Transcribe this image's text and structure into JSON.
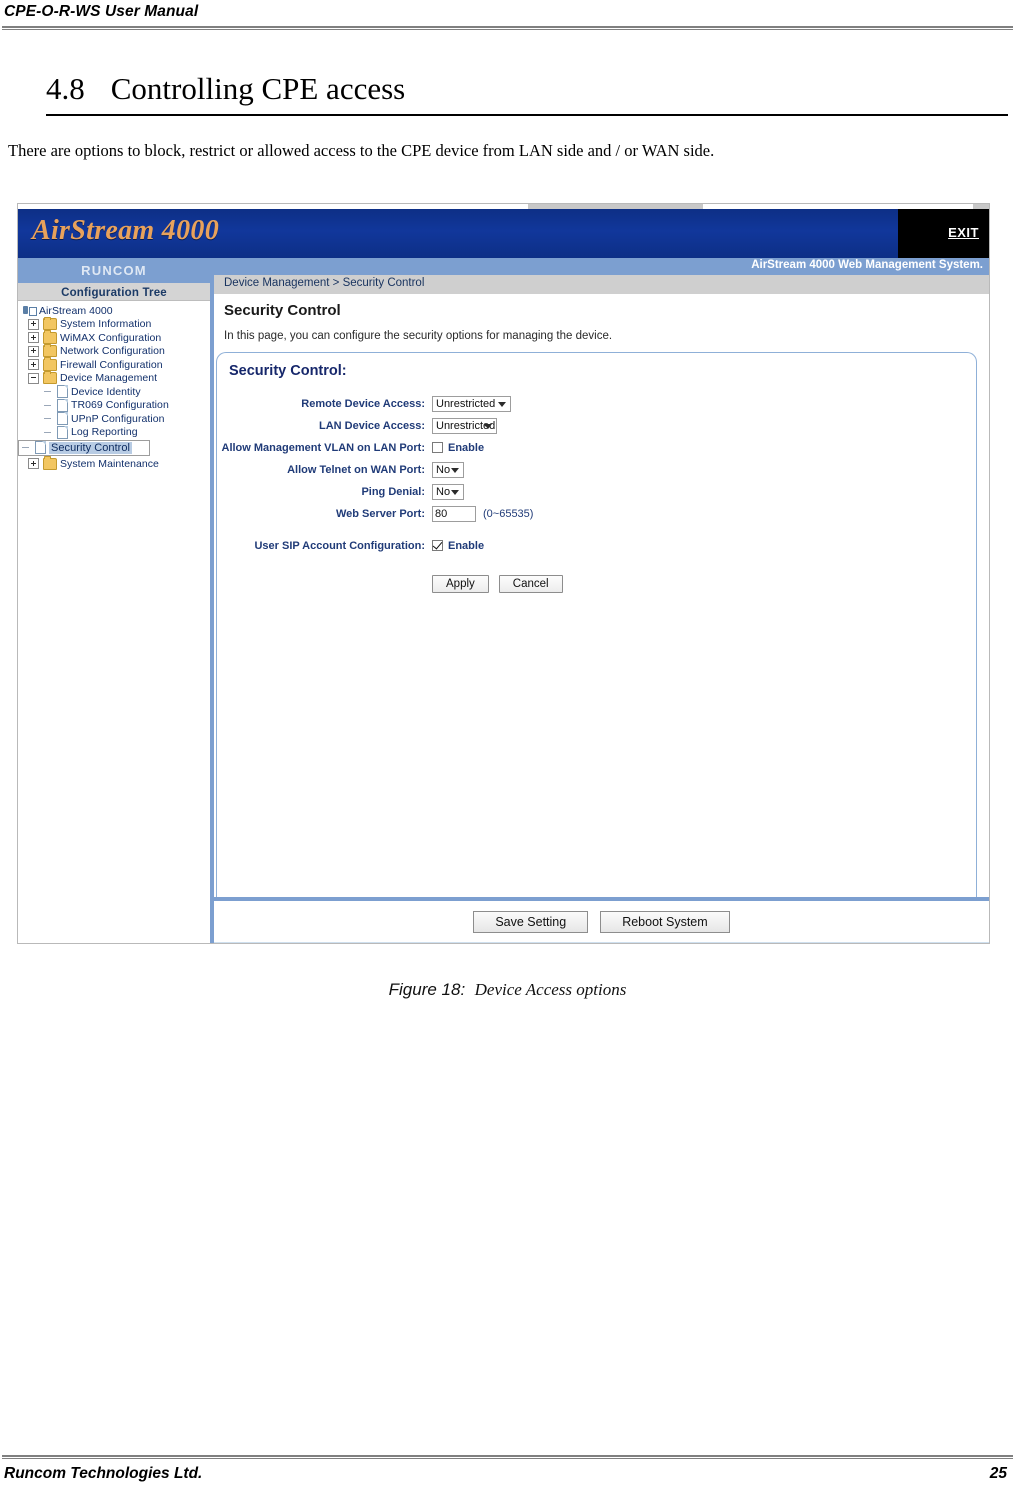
{
  "document": {
    "header_title": "CPE-O-R-WS User Manual",
    "section_number": "4.8",
    "section_title": "Controlling CPE access",
    "paragraph": "There are options to block, restrict or allowed access to the CPE device from LAN side and / or WAN side.",
    "figure_caption_label": "Figure 18:",
    "figure_caption_text": "Device Access options",
    "footer_company": "Runcom Technologies Ltd.",
    "footer_page": "25"
  },
  "screenshot": {
    "banner": {
      "logo": "AirStream 4000",
      "exit_label": "EXIT",
      "system_label": "AirStream 4000 Web Management System."
    },
    "sidebar": {
      "brand": "RUNCOM",
      "tree_title": "Configuration Tree",
      "tree": [
        {
          "label": "AirStream 4000",
          "level": 0,
          "icon": "root-icon",
          "toggle": "none",
          "selected": false
        },
        {
          "label": "System Information",
          "level": 1,
          "icon": "folder-icon",
          "toggle": "plus",
          "selected": false
        },
        {
          "label": "WiMAX Configuration",
          "level": 1,
          "icon": "folder-icon",
          "toggle": "plus",
          "selected": false
        },
        {
          "label": "Network Configuration",
          "level": 1,
          "icon": "folder-icon",
          "toggle": "plus",
          "selected": false
        },
        {
          "label": "Firewall Configuration",
          "level": 1,
          "icon": "folder-icon",
          "toggle": "plus",
          "selected": false
        },
        {
          "label": "Device Management",
          "level": 1,
          "icon": "folder-icon",
          "toggle": "minus",
          "selected": false
        },
        {
          "label": "Device Identity",
          "level": 2,
          "icon": "page-icon",
          "toggle": "dash",
          "selected": false
        },
        {
          "label": "TR069 Configuration",
          "level": 2,
          "icon": "page-icon",
          "toggle": "dash",
          "selected": false
        },
        {
          "label": "UPnP Configuration",
          "level": 2,
          "icon": "page-icon",
          "toggle": "dash",
          "selected": false
        },
        {
          "label": "Log Reporting",
          "level": 2,
          "icon": "page-icon",
          "toggle": "dash",
          "selected": false
        },
        {
          "label": "Security Control",
          "level": 2,
          "icon": "page-icon",
          "toggle": "dash",
          "selected": true
        },
        {
          "label": "System Maintenance",
          "level": 1,
          "icon": "folder-icon",
          "toggle": "plus",
          "selected": false
        }
      ]
    },
    "content": {
      "breadcrumb": "Device Management > Security Control",
      "page_title": "Security Control",
      "page_description": "In this page, you can configure the security options for managing the device.",
      "panel_title": "Security Control:",
      "fields": [
        {
          "label": "Remote Device Access:",
          "type": "select",
          "value": "Unrestricted",
          "width": "wide"
        },
        {
          "label": "LAN Device Access:",
          "type": "select",
          "value": "Unrestricted",
          "width": "med"
        },
        {
          "label": "Allow Management VLAN on LAN Port:",
          "type": "checkbox",
          "value": "Enable",
          "checked": false
        },
        {
          "label": "Allow Telnet on WAN Port:",
          "type": "select",
          "value": "No",
          "width": "sm"
        },
        {
          "label": "Ping Denial:",
          "type": "select",
          "value": "No",
          "width": "sm"
        },
        {
          "label": "Web Server Port:",
          "type": "text",
          "value": "80",
          "hint": "(0~65535)"
        },
        {
          "label": "User SIP Account Configuration:",
          "type": "checkbox",
          "value": "Enable",
          "checked": true
        }
      ],
      "apply_label": "Apply",
      "cancel_label": "Cancel",
      "save_setting_label": "Save Setting",
      "reboot_system_label": "Reboot System"
    }
  }
}
